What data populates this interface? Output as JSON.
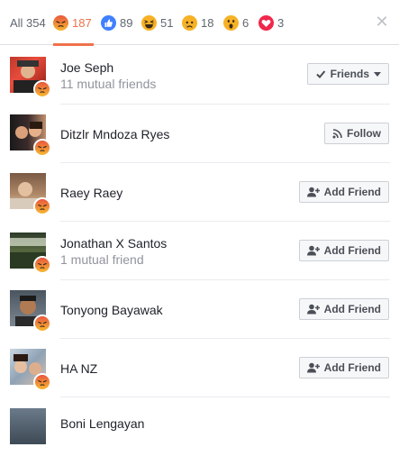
{
  "tabs": [
    {
      "label": "All 354"
    },
    {
      "icon": "angry-reaction-icon",
      "count": "187",
      "active": true
    },
    {
      "icon": "like-reaction-icon",
      "count": "89"
    },
    {
      "icon": "haha-reaction-icon",
      "count": "51"
    },
    {
      "icon": "sad-reaction-icon",
      "count": "18"
    },
    {
      "icon": "wow-reaction-icon",
      "count": "6"
    },
    {
      "icon": "love-reaction-icon",
      "count": "3"
    }
  ],
  "close_icon": "close-icon",
  "people": [
    {
      "name": "Joe Seph",
      "sub": "11 mutual friends",
      "button": "Friends",
      "button_icon": "checkmark-icon"
    },
    {
      "name": "Ditzlr Mndoza Ryes",
      "sub": "",
      "button": "Follow",
      "button_icon": "rss-icon"
    },
    {
      "name": "Raey Raey",
      "sub": "",
      "button": "Add Friend",
      "button_icon": "add-friend-icon"
    },
    {
      "name": "Jonathan X Santos",
      "sub": "1 mutual friend",
      "button": "Add Friend",
      "button_icon": "add-friend-icon"
    },
    {
      "name": "Tonyong Bayawak",
      "sub": "",
      "button": "Add Friend",
      "button_icon": "add-friend-icon"
    },
    {
      "name": "HA NZ",
      "sub": "",
      "button": "Add Friend",
      "button_icon": "add-friend-icon"
    },
    {
      "name": "Boni Lengayan",
      "sub": "",
      "button": "",
      "button_icon": ""
    }
  ],
  "colors": {
    "accent": "#f0714b",
    "angry": "#f0714b",
    "like": "#4080ff",
    "haha": "#f7b125",
    "love": "#f0284a"
  }
}
